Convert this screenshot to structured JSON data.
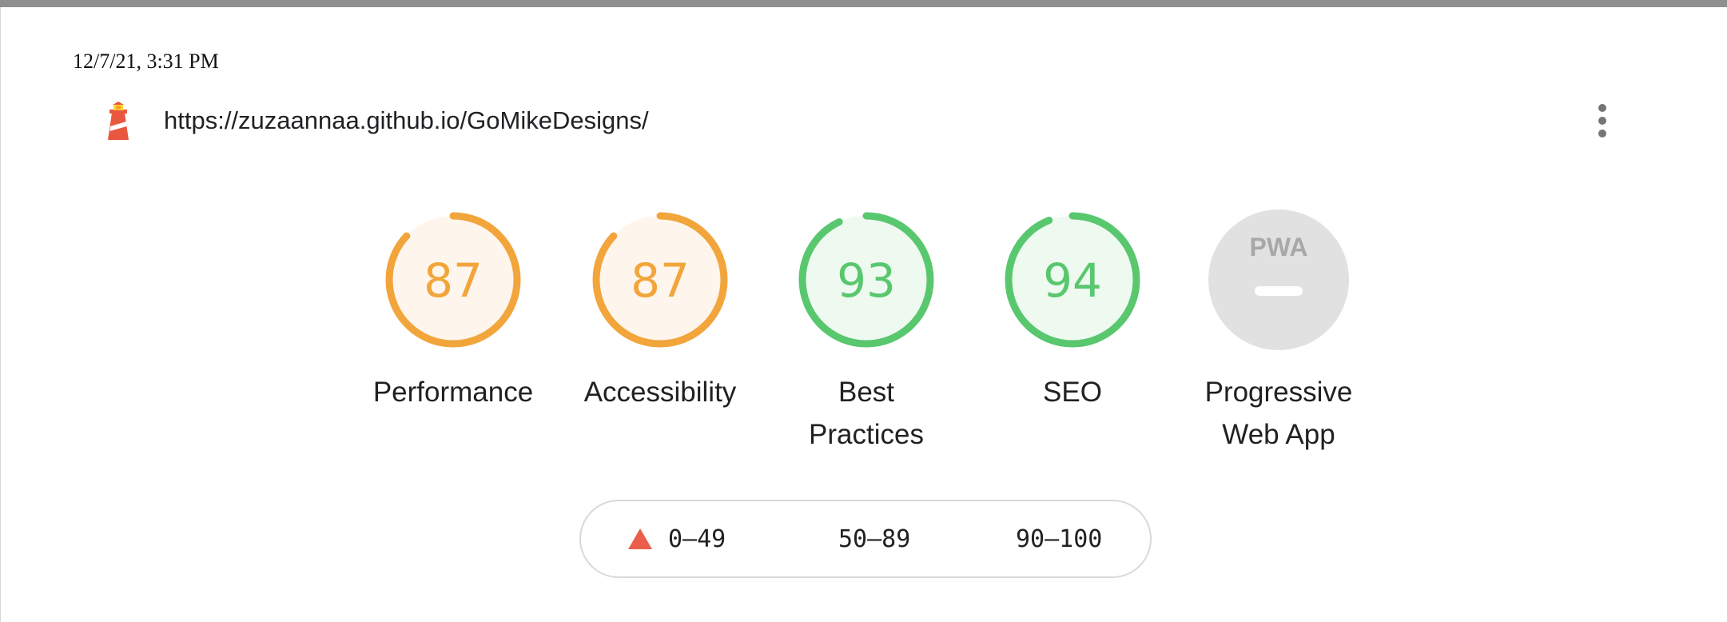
{
  "report": {
    "timestamp": "12/7/21, 3:31 PM",
    "url": "https://zuzaannaa.github.io/GoMikeDesigns/",
    "menu_icon": "three-dots-vertical-icon",
    "logo_icon": "lighthouse-icon"
  },
  "colors": {
    "average": "#f2a53a",
    "average_bg": "#fef5ec",
    "pass": "#59c76e",
    "pass_bg": "#eef9f0",
    "fail": "#eb5e4c",
    "pwa_bg": "#e1e1e1",
    "pwa_fg": "#ffffff",
    "pwa_logo": "#a8a8a8"
  },
  "gauges": [
    {
      "id": "performance",
      "score": 87,
      "score_text": "87",
      "rating": "average",
      "label_lines": [
        "Performance"
      ]
    },
    {
      "id": "accessibility",
      "score": 87,
      "score_text": "87",
      "rating": "average",
      "label_lines": [
        "Accessibility"
      ]
    },
    {
      "id": "best-practices",
      "score": 93,
      "score_text": "93",
      "rating": "pass",
      "label_lines": [
        "Best",
        "Practices"
      ]
    },
    {
      "id": "seo",
      "score": 94,
      "score_text": "94",
      "rating": "pass",
      "label_lines": [
        "SEO"
      ]
    },
    {
      "id": "pwa",
      "score": null,
      "score_text": "",
      "rating": "pwa",
      "badge_text": "PWA",
      "label_lines": [
        "Progressive",
        "Web App"
      ]
    }
  ],
  "legend": [
    {
      "range": "0–49",
      "rating": "fail",
      "marker_icon": "triangle-icon"
    },
    {
      "range": "50–89",
      "rating": "average",
      "marker_icon": "square-icon"
    },
    {
      "range": "90–100",
      "rating": "pass",
      "marker_icon": "circle-icon"
    }
  ]
}
